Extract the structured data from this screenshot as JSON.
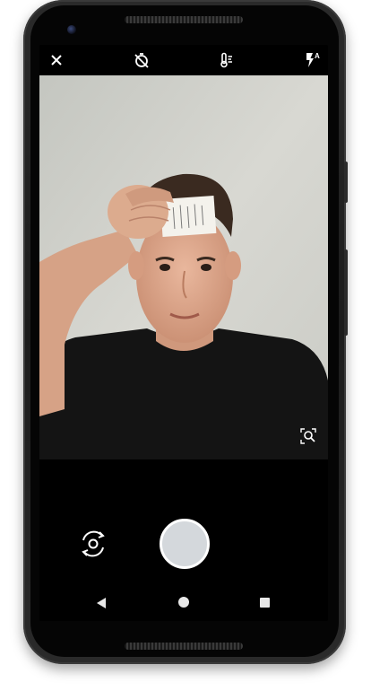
{
  "device": "Pixel phone",
  "top_bar": {
    "icons": [
      "close-icon",
      "timer-off-icon",
      "white-balance-icon",
      "flash-auto-icon"
    ],
    "flash_mode_label": "A"
  },
  "viewfinder": {
    "subject": "selfie-preview"
  },
  "controls": {
    "shutter": "shutter-button",
    "switch_camera": "switch-camera-icon",
    "zoom": "zoom-icon"
  },
  "nav": {
    "items": [
      "back",
      "home",
      "recents"
    ]
  },
  "colors": {
    "background": "#000000",
    "icon": "#ffffff",
    "shutter_fill": "#d4d8dc",
    "wall": "#d0d0ca"
  }
}
